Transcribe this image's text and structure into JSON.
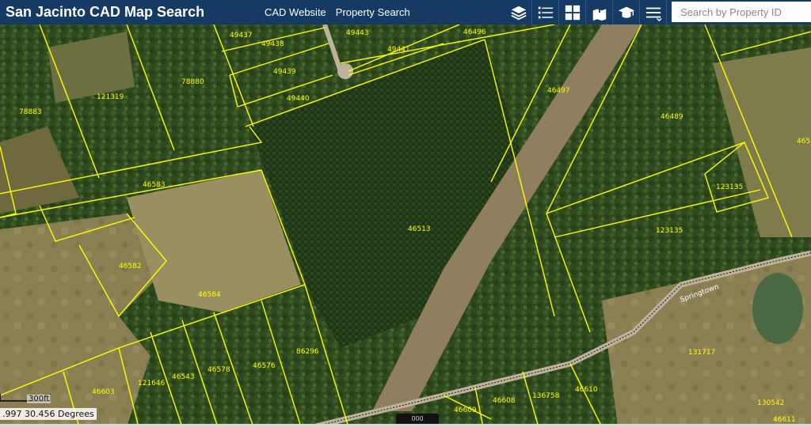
{
  "header": {
    "title": "San Jacinto CAD Map Search",
    "links": [
      "CAD Website",
      "Property Search"
    ],
    "tools": [
      "layers-icon",
      "legend-list-icon",
      "basemap-grid-icon",
      "bookmark-icon",
      "graduation-cap-icon",
      "menu-icon"
    ],
    "search_placeholder": "Search by Property ID",
    "bar_color": "#153a63"
  },
  "map": {
    "parcel_line_color": "#ffff00",
    "parcel_labels": [
      "49437",
      "49443",
      "46496",
      "49438",
      "49441",
      "78880",
      "49439",
      "121319",
      "78883",
      "49440",
      "46497",
      "46489",
      "46583",
      "123135",
      "46513",
      "123135",
      "46582",
      "46584",
      "86296",
      "46578",
      "46576",
      "46543",
      "121646",
      "46603",
      "131717",
      "136758",
      "46610",
      "46608",
      "46609",
      "130542",
      "46611",
      "465"
    ],
    "road_label": "Springtown",
    "scale_text": "300ft",
    "coordinate_text": ".997 30.456 Degrees",
    "attribution": "000"
  }
}
